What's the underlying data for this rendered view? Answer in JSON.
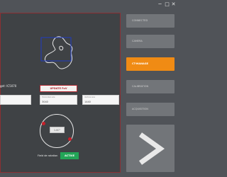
{
  "window": {
    "controls": [
      "minimize",
      "maximize",
      "close"
    ]
  },
  "target": {
    "label": "get: IC5070"
  },
  "update_button": "UPDATE FoV",
  "cards": [
    {
      "label": "",
      "value": ""
    },
    {
      "label": "Horizontal size",
      "value": "3040"
    },
    {
      "label": "Vertical size",
      "value": "1440"
    }
  ],
  "center_button": "1.0C°",
  "limit": {
    "label": "Field de rotation",
    "active_label": "ACTIVE"
  },
  "sidebar": {
    "items": [
      {
        "label": "CONNECTED",
        "selected": false
      },
      {
        "label": "CAMERA",
        "selected": false
      },
      {
        "label": "CT-MANAGE",
        "selected": true
      },
      {
        "label": "CALIBRATION",
        "selected": false
      },
      {
        "label": "ACQUISITION",
        "selected": false
      }
    ],
    "next_glyph": ">"
  },
  "colors": {
    "accent": "#f08b14",
    "selected_frame": "#1f3cc4",
    "danger": "#c7202a",
    "active": "#23a557"
  }
}
